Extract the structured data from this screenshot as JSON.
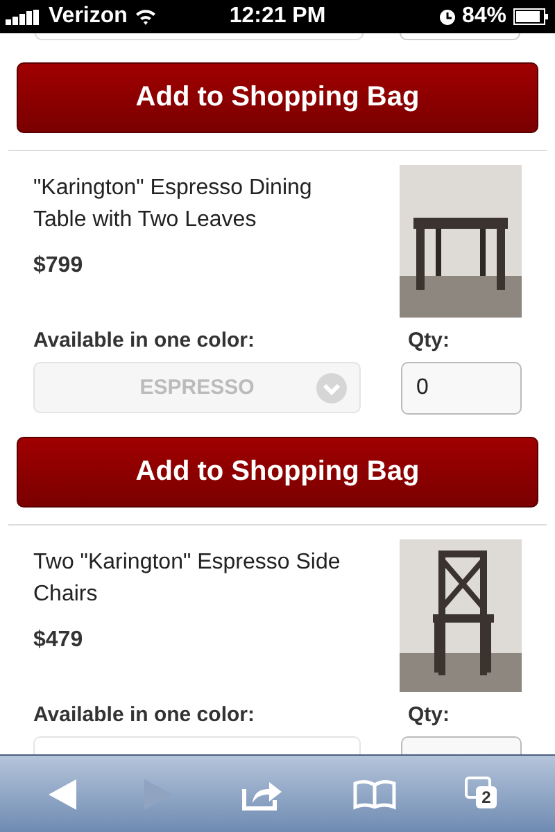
{
  "status_bar": {
    "carrier": "Verizon",
    "time": "12:21 PM",
    "battery": "84%"
  },
  "top_button": "Add to Shopping Bag",
  "products": [
    {
      "name": "\"Karington\" Espresso Dining Table with Two Leaves",
      "price": "$799",
      "kind": "table",
      "color_label": "Available in one color:",
      "qty_label": "Qty:",
      "color_select": {
        "value": "ESPRESSO",
        "disabled": true
      },
      "qty": "0",
      "button": "Add to Shopping Bag"
    },
    {
      "name": "Two \"Karington\" Espresso Side Chairs",
      "price": "$479",
      "kind": "chair",
      "color_label": "Available in one color:",
      "qty_label": "Qty:"
    }
  ],
  "toolbar": {
    "back_disabled": false,
    "forward_disabled": true,
    "tab_count": "2"
  }
}
